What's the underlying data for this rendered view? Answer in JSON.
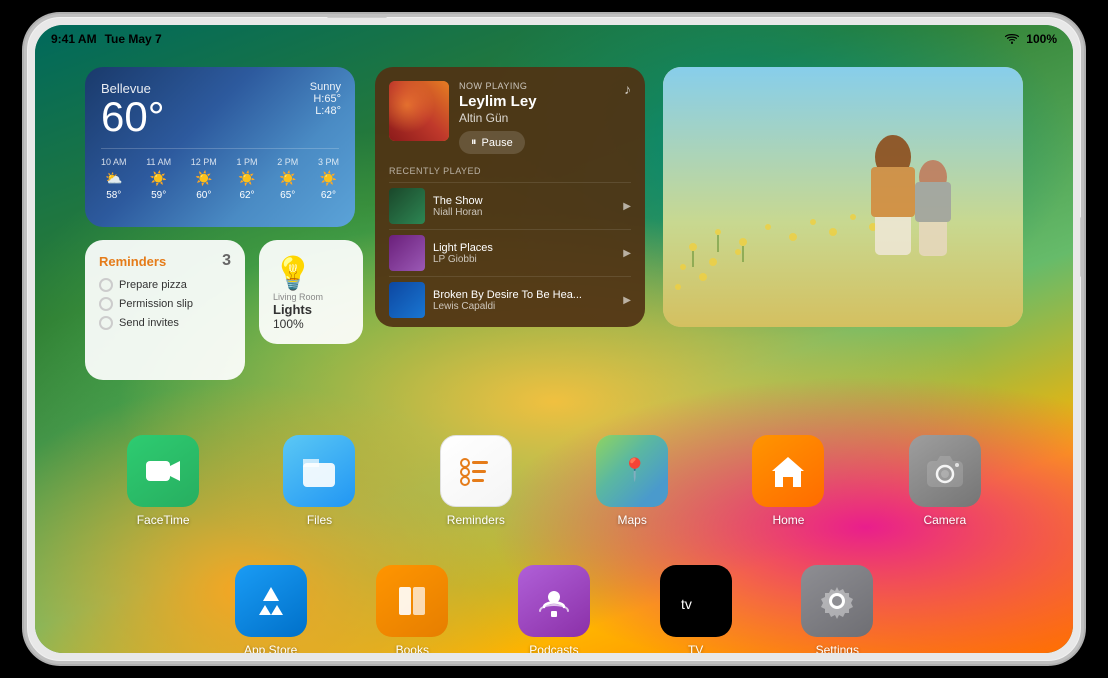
{
  "device": {
    "status_bar": {
      "time": "9:41 AM",
      "date": "Tue May 7",
      "battery": "100%",
      "wifi": true
    }
  },
  "widgets": {
    "weather": {
      "city": "Bellevue",
      "temp": "60°",
      "condition": "Sunny",
      "high": "H:65°",
      "low": "L:48°",
      "forecast": [
        {
          "time": "10 AM",
          "icon": "⛅",
          "temp": "58°"
        },
        {
          "time": "11 AM",
          "icon": "☀️",
          "temp": "59°"
        },
        {
          "time": "12 PM",
          "icon": "☀️",
          "temp": "60°"
        },
        {
          "time": "1 PM",
          "icon": "☀️",
          "temp": "62°"
        },
        {
          "time": "2 PM",
          "icon": "☀️",
          "temp": "65°"
        },
        {
          "time": "3 PM",
          "icon": "☀️",
          "temp": "62°"
        }
      ]
    },
    "music": {
      "now_playing_label": "NOW PLAYING",
      "song": "Leylim Ley",
      "artist": "Altin Gün",
      "pause_label": "Pause",
      "recently_played_label": "RECENTLY PLAYED",
      "tracks": [
        {
          "title": "The Show",
          "artist": "Niall Horan"
        },
        {
          "title": "Light Places",
          "artist": "LP Giobbi"
        },
        {
          "title": "Broken By Desire To Be Hea...",
          "artist": "Lewis Capaldi"
        }
      ]
    },
    "reminders": {
      "title": "Reminders",
      "count": "3",
      "items": [
        "Prepare pizza",
        "Permission slip",
        "Send invites"
      ]
    },
    "home": {
      "location": "Living Room",
      "device_name": "Lights",
      "value": "100%"
    }
  },
  "apps_row1": [
    {
      "id": "facetime",
      "label": "FaceTime"
    },
    {
      "id": "files",
      "label": "Files"
    },
    {
      "id": "reminders",
      "label": "Reminders"
    },
    {
      "id": "maps",
      "label": "Maps"
    },
    {
      "id": "home",
      "label": "Home"
    },
    {
      "id": "camera",
      "label": "Camera"
    }
  ],
  "apps_row2": [
    {
      "id": "appstore",
      "label": "App Store"
    },
    {
      "id": "books",
      "label": "Books"
    },
    {
      "id": "podcasts",
      "label": "Podcasts"
    },
    {
      "id": "tv",
      "label": "TV"
    },
    {
      "id": "settings",
      "label": "Settings"
    }
  ]
}
